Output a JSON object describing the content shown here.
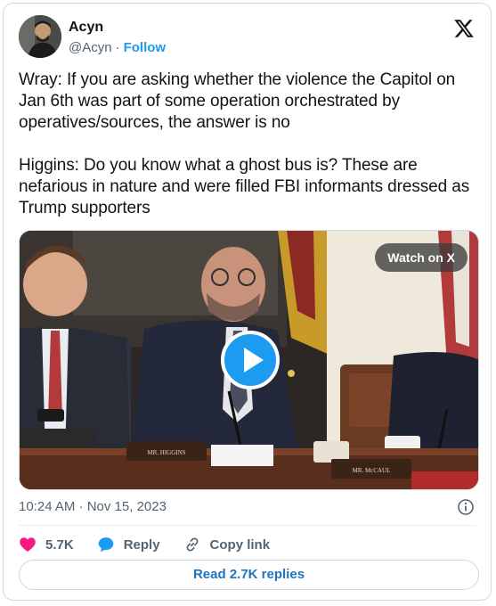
{
  "author": {
    "name": "Acyn",
    "handle": "@Acyn",
    "separator": "·",
    "follow_label": "Follow"
  },
  "tweet": {
    "text": "Wray: If you are asking whether the violence the Capitol on Jan 6th was part of some operation orchestrated by operatives/sources, the answer is no\n\nHiggins: Do you know what a ghost bus is? These are nefarious in nature and were filled FBI informants dressed as Trump supporters"
  },
  "media": {
    "watch_label": "Watch on X",
    "nameplate_left": "MR. HIGGINS",
    "nameplate_right": "MR. McCAUL"
  },
  "meta": {
    "timestamp": "10:24 AM · Nov 15, 2023"
  },
  "actions": {
    "like_count": "5.7K",
    "reply_label": "Reply",
    "copy_label": "Copy link"
  },
  "footer": {
    "read_replies_label": "Read 2.7K replies"
  },
  "colors": {
    "accent": "#1d9bf0",
    "like": "#f91880",
    "text": "#0f1419",
    "secondary": "#536471"
  }
}
